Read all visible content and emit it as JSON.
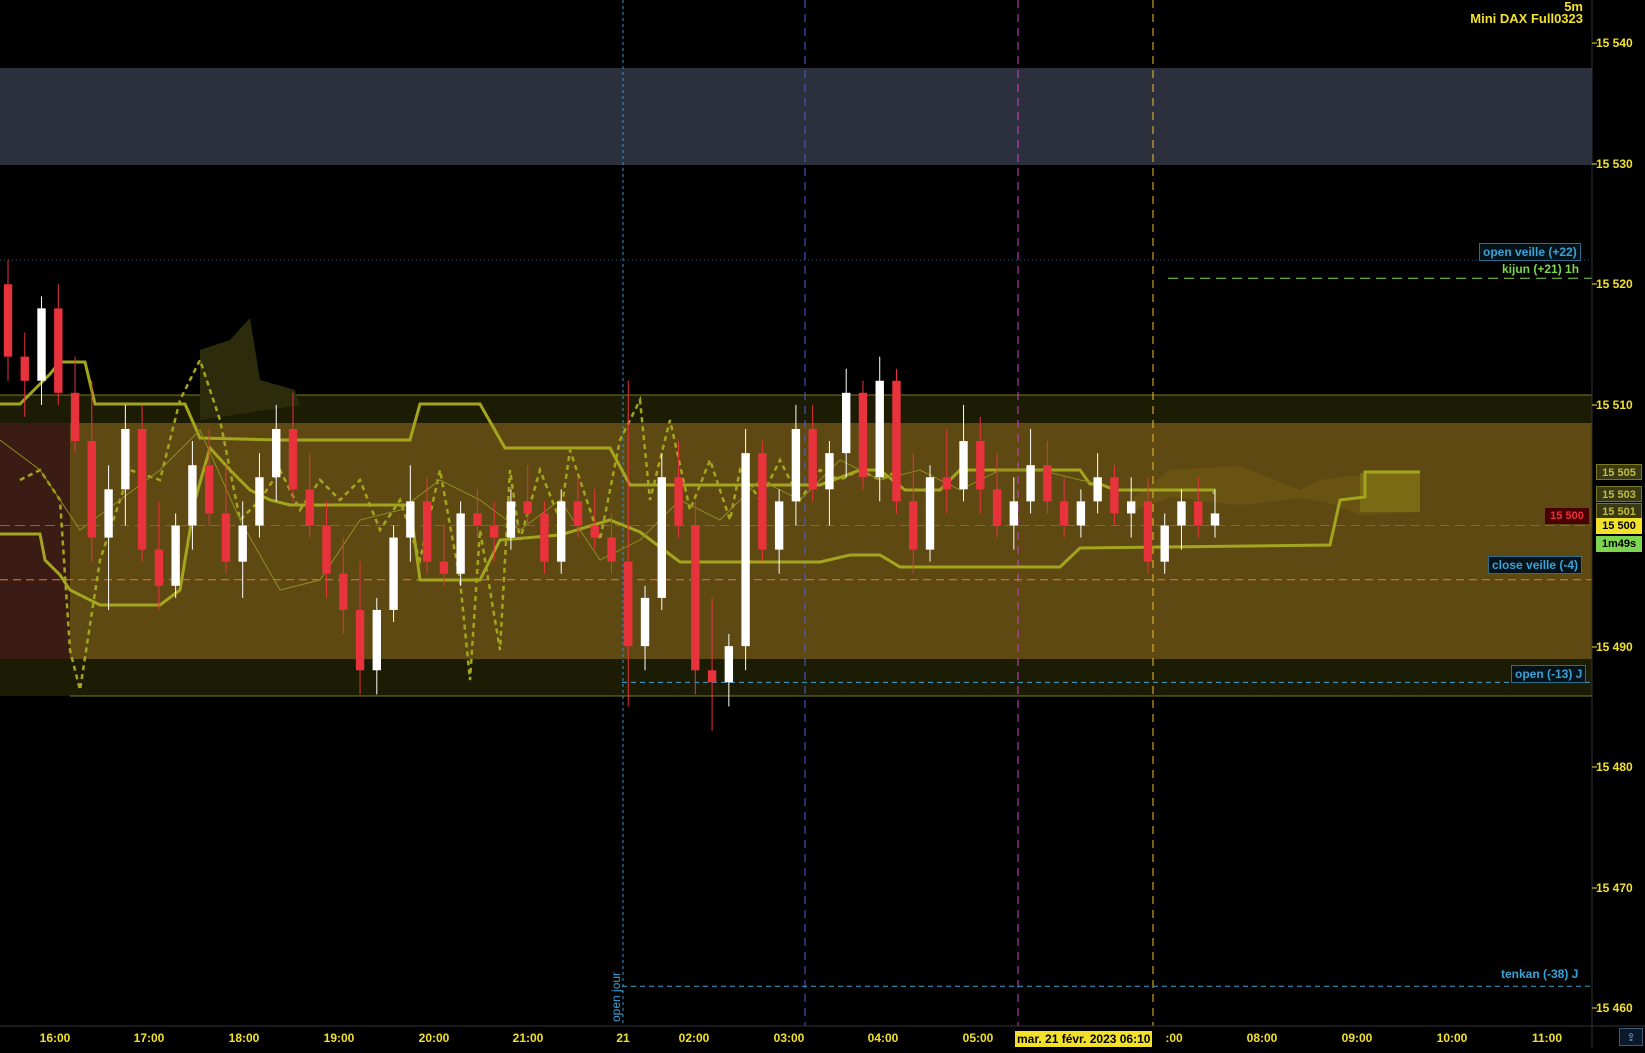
{
  "header": {
    "timeframe": "5m",
    "instrument": "Mini DAX Full0323"
  },
  "price_axis": {
    "ticks": [
      "15 540",
      "15 530",
      "15 520",
      "15 510",
      "15 490",
      "15 480",
      "15 470",
      "15 460"
    ],
    "ichimoku_labels": [
      "15 505",
      "15 503",
      "15 501"
    ],
    "current_price": "15 500",
    "candle_timer": "1m49s",
    "red_marker": "15 500"
  },
  "time_axis": {
    "ticks": [
      "16:00",
      "17:00",
      "18:00",
      "19:00",
      "20:00",
      "21:00",
      "21",
      "02:00",
      "03:00",
      "04:00",
      "05:00",
      "08:00",
      "09:00",
      "10:00",
      "11:00"
    ],
    "partial_tick": ":00",
    "cursor_date": "mar. 21 févr. 2023 06:10"
  },
  "levels": {
    "open_veille": "open veille (+22)",
    "kijun_1h": "kijun (+21) 1h",
    "close_veille": "close veille (-4)",
    "open_j": "open (-13) J",
    "tenkan_j": "tenkan (-38) J",
    "open_jour": "open jour"
  },
  "colors": {
    "background": "#000000",
    "candle_up": "#ffffff",
    "candle_down": "#e8323c",
    "ichimoku": "#a3a51e",
    "cloud": "#6b5714",
    "zone": "#2b303c",
    "axis_text": "#f2e12a",
    "level_blue": "#3aa3d6",
    "level_green": "#7cd650"
  },
  "chart_data": {
    "type": "candlestick",
    "ylim": [
      15458,
      15543
    ],
    "ylabel": "",
    "xlabel": "",
    "horizontal_levels": [
      {
        "name": "open veille (+22)",
        "value": 15522
      },
      {
        "name": "kijun (+21) 1h",
        "value": 15520.5
      },
      {
        "name": "close veille (-4)",
        "value": 15495.5
      },
      {
        "name": "open (-13) J",
        "value": 15487
      },
      {
        "name": "tenkan (-38) J",
        "value": 15461.8
      },
      {
        "name": "current",
        "value": 15500
      }
    ],
    "zones": [
      {
        "from": 15530,
        "to": 15538,
        "kind": "resistance"
      },
      {
        "from": 15489,
        "to": 15511,
        "kind": "range"
      }
    ],
    "candles": [
      [
        15520,
        15522,
        15512,
        15514
      ],
      [
        15514,
        15516,
        15509,
        15512
      ],
      [
        15512,
        15519,
        15510,
        15518
      ],
      [
        15518,
        15520,
        15510,
        15511
      ],
      [
        15511,
        15514,
        15506,
        15507
      ],
      [
        15507,
        15512,
        15497,
        15499
      ],
      [
        15499,
        15505,
        15493,
        15503
      ],
      [
        15503,
        15510,
        15500,
        15508
      ],
      [
        15508,
        15510,
        15497,
        15498
      ],
      [
        15498,
        15502,
        15493,
        15495
      ],
      [
        15495,
        15501,
        15494,
        15500
      ],
      [
        15500,
        15507,
        15498,
        15505
      ],
      [
        15505,
        15508,
        15500,
        15501
      ],
      [
        15501,
        15505,
        15496,
        15497
      ],
      [
        15497,
        15502,
        15494,
        15500
      ],
      [
        15500,
        15506,
        15499,
        15504
      ],
      [
        15504,
        15510,
        15502,
        15508
      ],
      [
        15508,
        15511,
        15502,
        15503
      ],
      [
        15503,
        15506,
        15499,
        15500
      ],
      [
        15500,
        15502,
        15494,
        15496
      ],
      [
        15496,
        15499,
        15491,
        15493
      ],
      [
        15493,
        15497,
        15486,
        15488
      ],
      [
        15488,
        15494,
        15486,
        15493
      ],
      [
        15493,
        15500,
        15492,
        15499
      ],
      [
        15499,
        15505,
        15497,
        15502
      ],
      [
        15502,
        15504,
        15496,
        15497
      ],
      [
        15497,
        15500,
        15495,
        15496
      ],
      [
        15496,
        15502,
        15495,
        15501
      ],
      [
        15501,
        15503,
        15499,
        15500
      ],
      [
        15500,
        15502,
        15497,
        15499
      ],
      [
        15499,
        15503,
        15498,
        15502
      ],
      [
        15502,
        15505,
        15500,
        15501
      ],
      [
        15501,
        15502,
        15496,
        15497
      ],
      [
        15497,
        15503,
        15496,
        15502
      ],
      [
        15502,
        15504,
        15499,
        15500
      ],
      [
        15500,
        15503,
        15498,
        15499
      ],
      [
        15499,
        15501,
        15496,
        15497
      ],
      [
        15497,
        15512,
        15485,
        15490
      ],
      [
        15490,
        15495,
        15488,
        15494
      ],
      [
        15494,
        15506,
        15493,
        15504
      ],
      [
        15504,
        15507,
        15499,
        15500
      ],
      [
        15500,
        15502,
        15486,
        15488
      ],
      [
        15488,
        15494,
        15483,
        15487
      ],
      [
        15487,
        15491,
        15485,
        15490
      ],
      [
        15490,
        15508,
        15488,
        15506
      ],
      [
        15506,
        15507,
        15497,
        15498
      ],
      [
        15498,
        15503,
        15496,
        15502
      ],
      [
        15502,
        15510,
        15500,
        15508
      ],
      [
        15508,
        15510,
        15502,
        15503
      ],
      [
        15503,
        15507,
        15500,
        15506
      ],
      [
        15506,
        15513,
        15504,
        15511
      ],
      [
        15511,
        15512,
        15503,
        15504
      ],
      [
        15504,
        15514,
        15502,
        15512
      ],
      [
        15512,
        15513,
        15501,
        15502
      ],
      [
        15502,
        15506,
        15496,
        15498
      ],
      [
        15498,
        15505,
        15497,
        15504
      ],
      [
        15504,
        15508,
        15501,
        15503
      ],
      [
        15503,
        15510,
        15502,
        15507
      ],
      [
        15507,
        15509,
        15501,
        15503
      ],
      [
        15503,
        15506,
        15499,
        15500
      ],
      [
        15500,
        15504,
        15498,
        15502
      ],
      [
        15502,
        15508,
        15501,
        15505
      ],
      [
        15505,
        15507,
        15501,
        15502
      ],
      [
        15502,
        15504,
        15499,
        15500
      ],
      [
        15500,
        15503,
        15499,
        15502
      ],
      [
        15502,
        15506,
        15501,
        15504
      ],
      [
        15504,
        15505,
        15500,
        15501
      ],
      [
        15501,
        15504,
        15499,
        15502
      ],
      [
        15502,
        15504,
        15496,
        15497
      ],
      [
        15497,
        15501,
        15496,
        15500
      ],
      [
        15500,
        15503,
        15498,
        15502
      ],
      [
        15502,
        15504,
        15499,
        15500
      ],
      [
        15500,
        15503,
        15499,
        15501
      ]
    ]
  }
}
